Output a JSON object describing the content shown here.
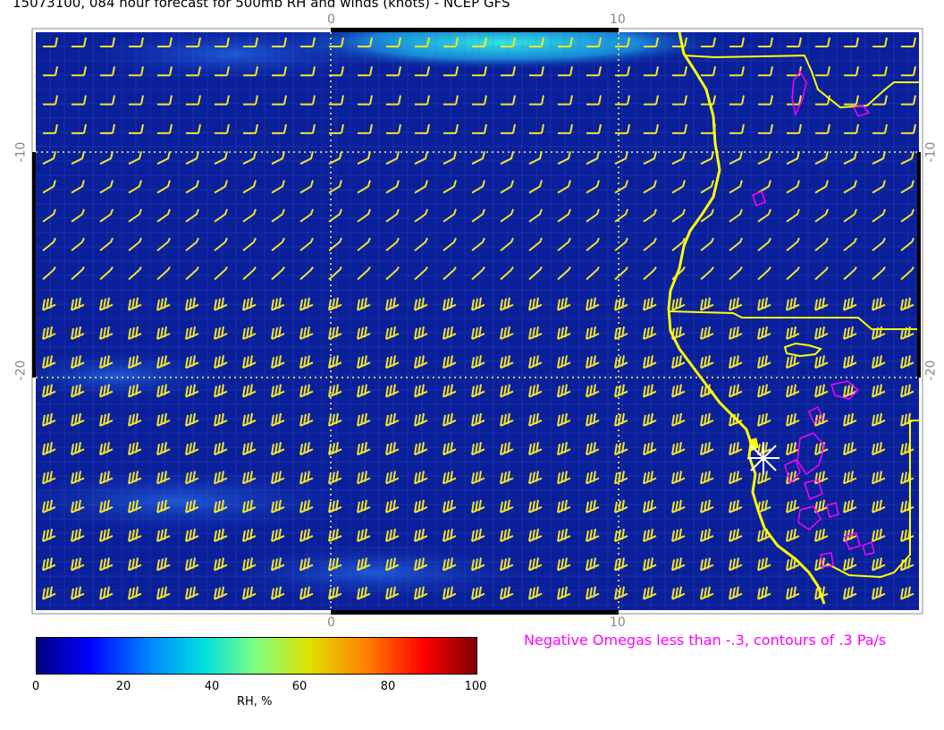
{
  "title": "15073100, 084 hour forecast for 500mb RH and winds (knots) - NCEP GFS",
  "top_ticks": [
    "0",
    "10"
  ],
  "bottom_ticks": [
    "0",
    "10"
  ],
  "left_ticks": [
    "-10",
    "-20"
  ],
  "right_ticks": [
    "-10",
    "-20"
  ],
  "omega_note": "Negative Omegas less than -.3, contours of .3 Pa/s",
  "colorbar": {
    "ticks": [
      "0",
      "20",
      "40",
      "60",
      "80",
      "100"
    ],
    "label": "RH, %"
  },
  "colors": {
    "field": "#0a1f9a",
    "coast": "#ffff00",
    "barb": "#f2e52a",
    "omega": "#ff00ff",
    "grid": "#ffff66"
  }
}
